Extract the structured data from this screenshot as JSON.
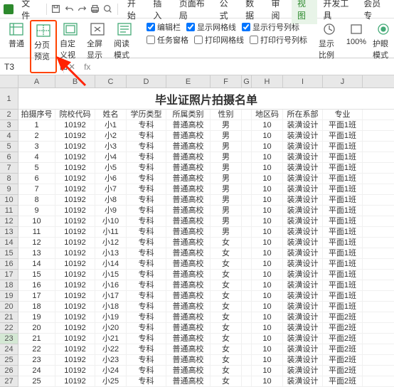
{
  "menubar": {
    "file": "文件",
    "tabs": [
      "开始",
      "插入",
      "页面布局",
      "公式",
      "数据",
      "审阅",
      "视图",
      "开发工具",
      "会员专"
    ],
    "active_tab": 6
  },
  "ribbon": {
    "buttons": [
      {
        "label": "普通",
        "name": "normal-view"
      },
      {
        "label": "分页预览",
        "name": "page-break-preview",
        "highlighted": true
      },
      {
        "label": "自定义视图",
        "name": "custom-view"
      },
      {
        "label": "全屏显示",
        "name": "fullscreen"
      },
      {
        "label": "阅读模式",
        "name": "reading-mode"
      }
    ],
    "checks_row1": [
      {
        "label": "编辑栏",
        "checked": true
      },
      {
        "label": "显示网格线",
        "checked": true
      },
      {
        "label": "显示行号列标",
        "checked": true
      }
    ],
    "checks_row2": [
      {
        "label": "任务窗格",
        "checked": false
      },
      {
        "label": "打印网格线",
        "checked": false
      },
      {
        "label": "打印行号列标",
        "checked": false
      }
    ],
    "right_buttons": [
      {
        "label": "显示比例",
        "name": "zoom"
      },
      {
        "label": "100%",
        "name": "zoom-100"
      },
      {
        "label": "护眼模式",
        "name": "eye-protect"
      }
    ]
  },
  "formula": {
    "name_box": "T3",
    "fx": "fx"
  },
  "sheet": {
    "title": "毕业证照片拍摄名单",
    "columns": [
      "A",
      "B",
      "C",
      "D",
      "E",
      "F",
      "G",
      "H",
      "I",
      "J"
    ],
    "headers": [
      "拍摄序号",
      "院校代码",
      "姓名",
      "学历类型",
      "所属类别",
      "性别",
      "",
      "地区码",
      "所在系部",
      "专业"
    ],
    "selected_row": 23,
    "rows": [
      [
        "1",
        "10192",
        "小1",
        "专科",
        "普通高校",
        "男",
        "",
        "10",
        "装潢设计",
        "平面1班"
      ],
      [
        "2",
        "10192",
        "小2",
        "专科",
        "普通高校",
        "男",
        "",
        "10",
        "装潢设计",
        "平面1班"
      ],
      [
        "3",
        "10192",
        "小3",
        "专科",
        "普通高校",
        "男",
        "",
        "10",
        "装潢设计",
        "平面1班"
      ],
      [
        "4",
        "10192",
        "小4",
        "专科",
        "普通高校",
        "男",
        "",
        "10",
        "装潢设计",
        "平面1班"
      ],
      [
        "5",
        "10192",
        "小5",
        "专科",
        "普通高校",
        "男",
        "",
        "10",
        "装潢设计",
        "平面1班"
      ],
      [
        "6",
        "10192",
        "小6",
        "专科",
        "普通高校",
        "男",
        "",
        "10",
        "装潢设计",
        "平面1班"
      ],
      [
        "7",
        "10192",
        "小7",
        "专科",
        "普通高校",
        "男",
        "",
        "10",
        "装潢设计",
        "平面1班"
      ],
      [
        "8",
        "10192",
        "小8",
        "专科",
        "普通高校",
        "男",
        "",
        "10",
        "装潢设计",
        "平面1班"
      ],
      [
        "9",
        "10192",
        "小9",
        "专科",
        "普通高校",
        "男",
        "",
        "10",
        "装潢设计",
        "平面1班"
      ],
      [
        "10",
        "10192",
        "小10",
        "专科",
        "普通高校",
        "男",
        "",
        "10",
        "装潢设计",
        "平面1班"
      ],
      [
        "11",
        "10192",
        "小11",
        "专科",
        "普通高校",
        "男",
        "",
        "10",
        "装潢设计",
        "平面1班"
      ],
      [
        "12",
        "10192",
        "小12",
        "专科",
        "普通高校",
        "女",
        "",
        "10",
        "装潢设计",
        "平面1班"
      ],
      [
        "13",
        "10192",
        "小13",
        "专科",
        "普通高校",
        "女",
        "",
        "10",
        "装潢设计",
        "平面1班"
      ],
      [
        "14",
        "10192",
        "小14",
        "专科",
        "普通高校",
        "女",
        "",
        "10",
        "装潢设计",
        "平面1班"
      ],
      [
        "15",
        "10192",
        "小15",
        "专科",
        "普通高校",
        "女",
        "",
        "10",
        "装潢设计",
        "平面1班"
      ],
      [
        "16",
        "10192",
        "小16",
        "专科",
        "普通高校",
        "女",
        "",
        "10",
        "装潢设计",
        "平面1班"
      ],
      [
        "17",
        "10192",
        "小17",
        "专科",
        "普通高校",
        "女",
        "",
        "10",
        "装潢设计",
        "平面1班"
      ],
      [
        "18",
        "10192",
        "小18",
        "专科",
        "普通高校",
        "女",
        "",
        "10",
        "装潢设计",
        "平面1班"
      ],
      [
        "19",
        "10192",
        "小19",
        "专科",
        "普通高校",
        "女",
        "",
        "10",
        "装潢设计",
        "平面2班"
      ],
      [
        "20",
        "10192",
        "小20",
        "专科",
        "普通高校",
        "女",
        "",
        "10",
        "装潢设计",
        "平面2班"
      ],
      [
        "21",
        "10192",
        "小21",
        "专科",
        "普通高校",
        "女",
        "",
        "10",
        "装潢设计",
        "平面2班"
      ],
      [
        "22",
        "10192",
        "小22",
        "专科",
        "普通高校",
        "女",
        "",
        "10",
        "装潢设计",
        "平面2班"
      ],
      [
        "23",
        "10192",
        "小23",
        "专科",
        "普通高校",
        "女",
        "",
        "10",
        "装潢设计",
        "平面2班"
      ],
      [
        "24",
        "10192",
        "小24",
        "专科",
        "普通高校",
        "女",
        "",
        "10",
        "装潢设计",
        "平面2班"
      ],
      [
        "25",
        "10192",
        "小25",
        "专科",
        "普通高校",
        "女",
        "",
        "10",
        "装潢设计",
        "平面2班"
      ]
    ]
  }
}
